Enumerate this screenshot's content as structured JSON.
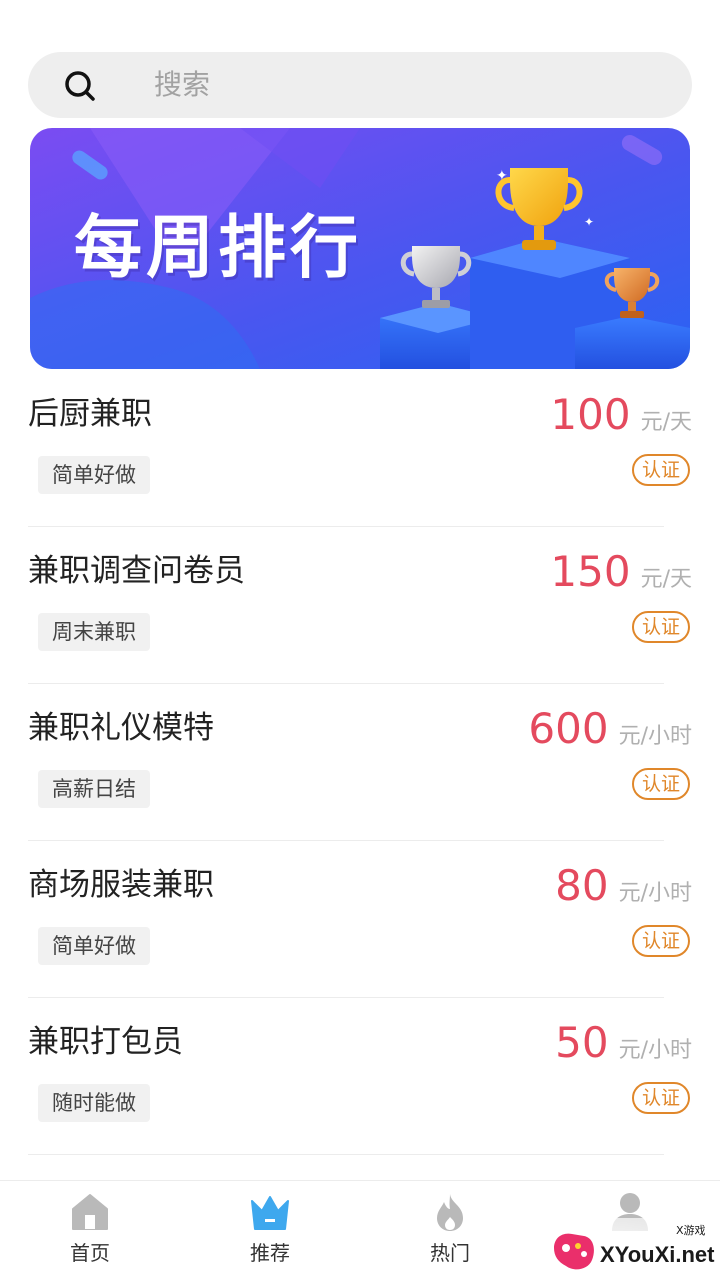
{
  "search": {
    "placeholder": "搜索"
  },
  "banner": {
    "title": "每周排行"
  },
  "jobs": [
    {
      "title": "后厨兼职",
      "tag": "简单好做",
      "amount": "100",
      "unit": "元/天",
      "badge": "认证"
    },
    {
      "title": "兼职调查问卷员",
      "tag": "周末兼职",
      "amount": "150",
      "unit": "元/天",
      "badge": "认证"
    },
    {
      "title": "兼职礼仪模特",
      "tag": "高薪日结",
      "amount": "600",
      "unit": "元/小时",
      "badge": "认证"
    },
    {
      "title": "商场服装兼职",
      "tag": "简单好做",
      "amount": "80",
      "unit": "元/小时",
      "badge": "认证"
    },
    {
      "title": "兼职打包员",
      "tag": "随时能做",
      "amount": "50",
      "unit": "元/小时",
      "badge": "认证"
    }
  ],
  "tabs": [
    {
      "label": "首页",
      "icon": "home-icon",
      "active": false
    },
    {
      "label": "推荐",
      "icon": "crown-icon",
      "active": true
    },
    {
      "label": "热门",
      "icon": "flame-icon",
      "active": false
    },
    {
      "label": "",
      "icon": "user-icon",
      "active": false
    }
  ],
  "watermark": {
    "text": "XYouXi.net",
    "sub": "X游戏"
  },
  "colors": {
    "price": "#e44a5e",
    "badge": "#e0872a",
    "active_tab": "#3ea8ee",
    "inactive_tab": "#b9b9b9"
  }
}
